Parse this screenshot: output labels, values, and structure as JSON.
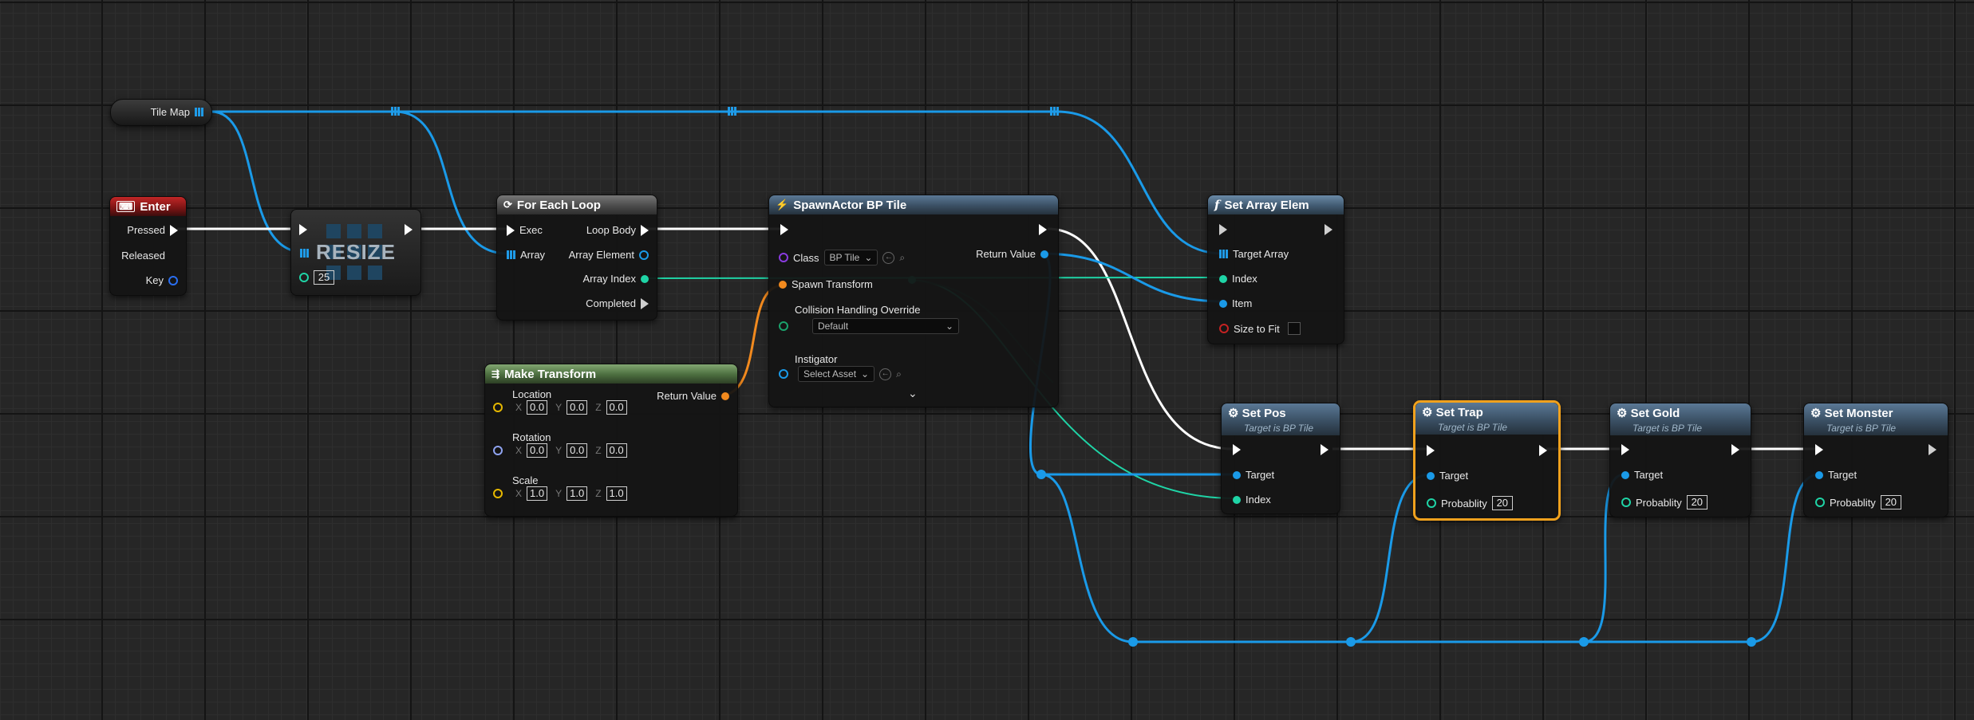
{
  "colors": {
    "object_wire": "#1a9ae8",
    "int_wire": "#1fd4a6",
    "exec_wire": "#ffffff",
    "transform_wire": "#f28a1e",
    "selected_outline": "#f0a11d"
  },
  "tile_map": {
    "label": "Tile Map"
  },
  "enter_node": {
    "title": "Enter",
    "icon": "keyboard-icon",
    "pins": {
      "pressed": "Pressed",
      "released": "Released",
      "key": "Key"
    }
  },
  "resize_node": {
    "text": "RESIZE",
    "value": "25"
  },
  "for_each": {
    "title": "For Each Loop",
    "exec": "Exec",
    "array": "Array",
    "loop_body": "Loop Body",
    "array_element": "Array Element",
    "array_index": "Array Index",
    "completed": "Completed"
  },
  "make_transform": {
    "title": "Make Transform",
    "location": "Location",
    "rotation": "Rotation",
    "scale": "Scale",
    "return_value": "Return Value",
    "axes": {
      "x": "X",
      "y": "Y",
      "z": "Z"
    },
    "location_values": [
      "0.0",
      "0.0",
      "0.0"
    ],
    "rotation_values": [
      "0.0",
      "0.0",
      "0.0"
    ],
    "scale_values": [
      "1.0",
      "1.0",
      "1.0"
    ]
  },
  "spawn_actor": {
    "title": "SpawnActor BP Tile",
    "class_label": "Class",
    "class_value": "BP Tile",
    "spawn_transform": "Spawn Transform",
    "collision_label": "Collision Handling Override",
    "collision_value": "Default",
    "instigator_label": "Instigator",
    "instigator_placeholder": "Select Asset",
    "return_value": "Return Value"
  },
  "set_array": {
    "title": "Set Array Elem",
    "target_array": "Target Array",
    "index": "Index",
    "item": "Item",
    "size_to_fit": "Size to Fit"
  },
  "set_pos": {
    "title": "Set Pos",
    "subtitle": "Target is BP Tile",
    "target": "Target",
    "index": "Index"
  },
  "set_trap": {
    "title": "Set Trap",
    "subtitle": "Target is BP Tile",
    "target": "Target",
    "prob_label": "Probablity",
    "prob_value": "20"
  },
  "set_gold": {
    "title": "Set Gold",
    "subtitle": "Target is BP Tile",
    "target": "Target",
    "prob_label": "Probablity",
    "prob_value": "20"
  },
  "set_monster": {
    "title": "Set Monster",
    "subtitle": "Target is BP Tile",
    "target": "Target",
    "prob_label": "Probablity",
    "prob_value": "20"
  }
}
